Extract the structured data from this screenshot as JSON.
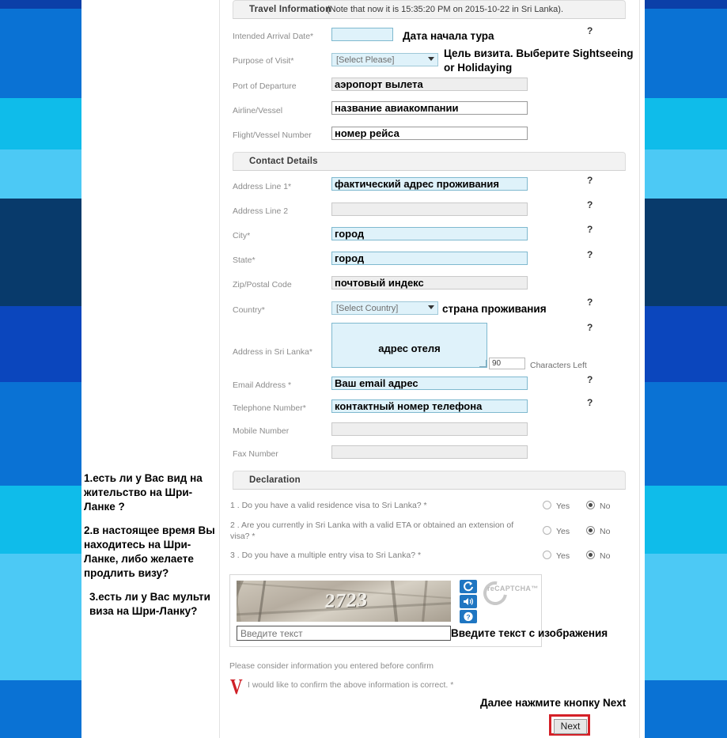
{
  "background": {
    "stripe_colors": [
      "#0b3fa8",
      "#0a72d4",
      "#0fbcea",
      "#4cc9f5",
      "#083a6b",
      "#0b46bd",
      "#0a72d4",
      "#0fbcea",
      "#4cc9f5",
      "#0a72d4"
    ]
  },
  "left_notes": [
    "1.есть ли у Вас вид на жительство на Шри-Ланке ?",
    "2.в настоящее время Вы находитесь на Шри-Ланке, либо желаете продлить визу?",
    "3.есть ли у Вас мульти виза на Шри-Ланку?"
  ],
  "travel_section": {
    "title": "Travel Information",
    "note": "(Note that now it is 15:35:20 PM on 2015-10-22 in Sri Lanka).",
    "fields": [
      {
        "label": "Intended Arrival Date*",
        "value": "",
        "annotation": "Дата начала тура",
        "help": "?"
      },
      {
        "label": "Purpose of Visit*",
        "value": "[Select Please]",
        "annotation": "Цель визита. Выберите Sightseeing or Holidaying",
        "help": ""
      },
      {
        "label": "Port of Departure",
        "value": "аэропорт вылета",
        "annotation": "",
        "help": ""
      },
      {
        "label": "Airline/Vessel",
        "value": "название авиакомпании",
        "annotation": "",
        "help": ""
      },
      {
        "label": "Flight/Vessel Number",
        "value": "номер рейса",
        "annotation": "",
        "help": ""
      }
    ]
  },
  "contact_section": {
    "title": "Contact Details",
    "fields": [
      {
        "label": "Address Line 1*",
        "value": "фактический адрес проживания",
        "annotation": "",
        "help": "?"
      },
      {
        "label": "Address Line 2",
        "value": "",
        "annotation": "",
        "help": "?"
      },
      {
        "label": "City*",
        "value": "город",
        "annotation": "",
        "help": "?"
      },
      {
        "label": "State*",
        "value": "город",
        "annotation": "",
        "help": "?"
      },
      {
        "label": "Zip/Postal Code",
        "value": "почтовый индекс",
        "annotation": "",
        "help": ""
      },
      {
        "label": "Country*",
        "value": "[Select Country]",
        "annotation": "страна проживания",
        "help": "?"
      },
      {
        "label": "Address in Sri Lanka*",
        "value": "адрес отеля",
        "annotation": "",
        "help": "?"
      },
      {
        "label": "Email Address *",
        "value": "Ваш email адрес",
        "annotation": "",
        "help": "?"
      },
      {
        "label": "Telephone Number*",
        "value": "контактный номер телефона",
        "annotation": "",
        "help": "?"
      },
      {
        "label": "Mobile Number",
        "value": "",
        "annotation": "",
        "help": ""
      },
      {
        "label": "Fax Number",
        "value": "",
        "annotation": "",
        "help": ""
      }
    ],
    "chars_left_value": "90",
    "chars_left_label": "Characters Left"
  },
  "declaration_section": {
    "title": "Declaration",
    "questions": [
      {
        "text": "1 . Do you have a valid residence visa to Sri Lanka? *",
        "yes_label": "Yes",
        "no_label": "No",
        "selected": "No"
      },
      {
        "text": "2 . Are you currently in Sri Lanka with a valid ETA or obtained an extension of visa? *",
        "yes_label": "Yes",
        "no_label": "No",
        "selected": "No"
      },
      {
        "text": "3 . Do you have a multiple entry visa to Sri Lanka? *",
        "yes_label": "Yes",
        "no_label": "No",
        "selected": "No"
      }
    ]
  },
  "captcha": {
    "image_text": "2723",
    "input_placeholder": "Введите текст",
    "annotation": "Введите текст с изображения",
    "brand": "reCAPTCHA™",
    "buttons": [
      "refresh-icon",
      "audio-icon",
      "help-icon"
    ]
  },
  "footer": {
    "consider_text": "Please consider information you entered before confirm",
    "confirm_text": "I would like to confirm the above information is correct. *",
    "confirm_mark": "V",
    "next_annotation": "Далее нажмите кнопку Next",
    "next_label": "Next"
  }
}
